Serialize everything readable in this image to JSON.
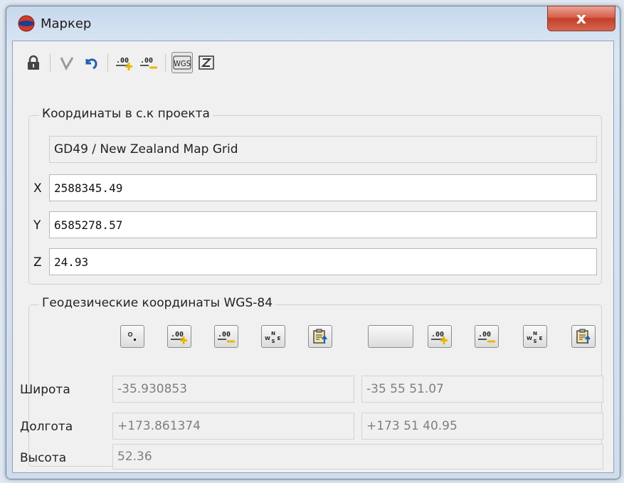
{
  "window": {
    "title": "Маркер",
    "close_glyph": "x"
  },
  "toolbar": {
    "icons": [
      "lock-icon",
      "check-icon",
      "undo-icon",
      "add-digits-icon",
      "remove-digits-icon",
      "wgs-toggle-icon",
      "z-toggle-icon"
    ],
    "wgs_label": "WGS"
  },
  "project_coords": {
    "group_title": "Координаты в с.к проекта",
    "crs_name": "GD49 / New Zealand Map Grid",
    "x_label": "X",
    "x_value": "2588345.49",
    "y_label": "Y",
    "y_value": "6585278.57",
    "z_label": "Z",
    "z_value": "24.93"
  },
  "geodetic": {
    "group_title": "Геодезические координаты WGS-84",
    "lat_label": "Широта",
    "lat_decimal": "-35.930853",
    "lat_dms": "-35 55 51.07",
    "lon_label": "Долгота",
    "lon_decimal": "+173.861374",
    "lon_dms": "+173 51 40.95",
    "height_label": "Высота",
    "height_value": "52.36"
  },
  "colors": {
    "accent_blue": "#1f5fb5",
    "close_red": "#c2402a",
    "plus_yellow": "#e8b800",
    "window_border": "#6f86a3"
  }
}
